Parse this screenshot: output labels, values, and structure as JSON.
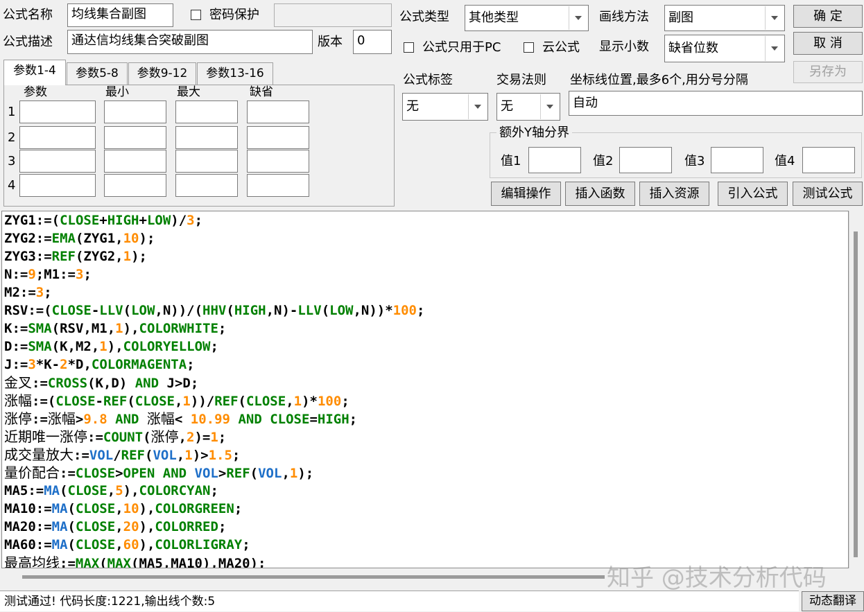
{
  "header": {
    "name_label": "公式名称",
    "name_value": "均线集合副图",
    "password_label": "密码保护",
    "desc_label": "公式描述",
    "desc_value": "通达信均线集合突破副图",
    "version_label": "版本",
    "version_value": "0",
    "type_label": "公式类型",
    "type_value": "其他类型",
    "draw_label": "画线方法",
    "draw_value": "副图",
    "pc_only_label": "公式只用于PC",
    "cloud_label": "云公式",
    "decimals_label": "显示小数",
    "decimals_value": "缺省位数"
  },
  "buttons": {
    "ok": "确  定",
    "cancel": "取  消",
    "save_as": "另存为"
  },
  "tabs": [
    "参数1-4",
    "参数5-8",
    "参数9-12",
    "参数13-16"
  ],
  "params": {
    "headers": [
      "参数",
      "最小",
      "最大",
      "缺省"
    ],
    "rows": [
      "1",
      "2",
      "3",
      "4"
    ]
  },
  "options": {
    "tag_label": "公式标签",
    "tag_value": "无",
    "rule_label": "交易法则",
    "rule_value": "无",
    "coord_label": "坐标线位置,最多6个,用分号分隔",
    "coord_value": "自动",
    "yaxis_group": "额外Y轴分界",
    "y_labels": [
      "值1",
      "值2",
      "值3",
      "值4"
    ]
  },
  "actions": [
    "编辑操作",
    "插入函数",
    "插入资源",
    "引入公式",
    "测试公式"
  ],
  "code_lines": [
    [
      [
        "t",
        "ZYG1:=("
      ],
      [
        "fn",
        "CLOSE"
      ],
      [
        "t",
        "+"
      ],
      [
        "fn",
        "HIGH"
      ],
      [
        "t",
        "+"
      ],
      [
        "fn",
        "LOW"
      ],
      [
        "t",
        ")/"
      ],
      [
        "num",
        "3"
      ],
      [
        "t",
        ";"
      ]
    ],
    [
      [
        "t",
        "ZYG2:="
      ],
      [
        "fn",
        "EMA"
      ],
      [
        "t",
        "(ZYG1,"
      ],
      [
        "num",
        "10"
      ],
      [
        "t",
        ");"
      ]
    ],
    [
      [
        "t",
        "ZYG3:="
      ],
      [
        "fn",
        "REF"
      ],
      [
        "t",
        "(ZYG2,"
      ],
      [
        "num",
        "1"
      ],
      [
        "t",
        ");"
      ]
    ],
    [
      [
        "t",
        "N:="
      ],
      [
        "num",
        "9"
      ],
      [
        "t",
        ";M1:="
      ],
      [
        "num",
        "3"
      ],
      [
        "t",
        ";"
      ]
    ],
    [
      [
        "t",
        "M2:="
      ],
      [
        "num",
        "3"
      ],
      [
        "t",
        ";"
      ]
    ],
    [
      [
        "t",
        "RSV:=("
      ],
      [
        "fn",
        "CLOSE"
      ],
      [
        "t",
        "-"
      ],
      [
        "fn",
        "LLV"
      ],
      [
        "t",
        "("
      ],
      [
        "fn",
        "LOW"
      ],
      [
        "t",
        ",N))/("
      ],
      [
        "fn",
        "HHV"
      ],
      [
        "t",
        "("
      ],
      [
        "fn",
        "HIGH"
      ],
      [
        "t",
        ",N)-"
      ],
      [
        "fn",
        "LLV"
      ],
      [
        "t",
        "("
      ],
      [
        "fn",
        "LOW"
      ],
      [
        "t",
        ",N))*"
      ],
      [
        "num",
        "100"
      ],
      [
        "t",
        ";"
      ]
    ],
    [
      [
        "t",
        "K:="
      ],
      [
        "fn",
        "SMA"
      ],
      [
        "t",
        "(RSV,M1,"
      ],
      [
        "num",
        "1"
      ],
      [
        "t",
        "),"
      ],
      [
        "col",
        "COLORWHITE"
      ],
      [
        "t",
        ";"
      ]
    ],
    [
      [
        "t",
        "D:="
      ],
      [
        "fn",
        "SMA"
      ],
      [
        "t",
        "(K,M2,"
      ],
      [
        "num",
        "1"
      ],
      [
        "t",
        "),"
      ],
      [
        "col",
        "COLORYELLOW"
      ],
      [
        "t",
        ";"
      ]
    ],
    [
      [
        "t",
        "J:="
      ],
      [
        "num",
        "3"
      ],
      [
        "t",
        "*K-"
      ],
      [
        "num",
        "2"
      ],
      [
        "t",
        "*D,"
      ],
      [
        "col",
        "COLORMAGENTA"
      ],
      [
        "t",
        ";"
      ]
    ],
    [
      [
        "cn",
        "金叉"
      ],
      [
        "t",
        ":="
      ],
      [
        "fn",
        "CROSS"
      ],
      [
        "t",
        "(K,D) "
      ],
      [
        "kw",
        "AND"
      ],
      [
        "t",
        " J>D;"
      ]
    ],
    [
      [
        "cn",
        "涨幅"
      ],
      [
        "t",
        ":=("
      ],
      [
        "fn",
        "CLOSE"
      ],
      [
        "t",
        "-"
      ],
      [
        "fn",
        "REF"
      ],
      [
        "t",
        "("
      ],
      [
        "fn",
        "CLOSE"
      ],
      [
        "t",
        ","
      ],
      [
        "num",
        "1"
      ],
      [
        "t",
        "))/"
      ],
      [
        "fn",
        "REF"
      ],
      [
        "t",
        "("
      ],
      [
        "fn",
        "CLOSE"
      ],
      [
        "t",
        ","
      ],
      [
        "num",
        "1"
      ],
      [
        "t",
        ")*"
      ],
      [
        "num",
        "100"
      ],
      [
        "t",
        ";"
      ]
    ],
    [
      [
        "cn",
        "涨停"
      ],
      [
        "t",
        ":="
      ],
      [
        "cn",
        "涨幅"
      ],
      [
        "t",
        ">"
      ],
      [
        "num",
        "9.8"
      ],
      [
        "t",
        " "
      ],
      [
        "kw",
        "AND"
      ],
      [
        "t",
        " "
      ],
      [
        "cn",
        "涨幅"
      ],
      [
        "t",
        "< "
      ],
      [
        "num",
        "10.99"
      ],
      [
        "t",
        " "
      ],
      [
        "kw",
        "AND"
      ],
      [
        "t",
        " "
      ],
      [
        "fn",
        "CLOSE"
      ],
      [
        "t",
        "="
      ],
      [
        "fn",
        "HIGH"
      ],
      [
        "t",
        ";"
      ]
    ],
    [
      [
        "cn",
        "近期唯一涨停"
      ],
      [
        "t",
        ":="
      ],
      [
        "fn",
        "COUNT"
      ],
      [
        "t",
        "("
      ],
      [
        "cn",
        "涨停"
      ],
      [
        "t",
        ","
      ],
      [
        "num",
        "2"
      ],
      [
        "t",
        ")="
      ],
      [
        "num",
        "1"
      ],
      [
        "t",
        ";"
      ]
    ],
    [
      [
        "cn",
        "成交量放大"
      ],
      [
        "t",
        ":="
      ],
      [
        "fb",
        "VOL"
      ],
      [
        "t",
        "/"
      ],
      [
        "fn",
        "REF"
      ],
      [
        "t",
        "("
      ],
      [
        "fb",
        "VOL"
      ],
      [
        "t",
        ","
      ],
      [
        "num",
        "1"
      ],
      [
        "t",
        ")>"
      ],
      [
        "num",
        "1.5"
      ],
      [
        "t",
        ";"
      ]
    ],
    [
      [
        "cn",
        "量价配合"
      ],
      [
        "t",
        ":="
      ],
      [
        "fn",
        "CLOSE"
      ],
      [
        "t",
        ">"
      ],
      [
        "fn",
        "OPEN"
      ],
      [
        "t",
        " "
      ],
      [
        "kw",
        "AND"
      ],
      [
        "t",
        " "
      ],
      [
        "fb",
        "VOL"
      ],
      [
        "t",
        ">"
      ],
      [
        "fn",
        "REF"
      ],
      [
        "t",
        "("
      ],
      [
        "fb",
        "VOL"
      ],
      [
        "t",
        ","
      ],
      [
        "num",
        "1"
      ],
      [
        "t",
        ");"
      ]
    ],
    [
      [
        "t",
        "MA5:="
      ],
      [
        "fb",
        "MA"
      ],
      [
        "t",
        "("
      ],
      [
        "fn",
        "CLOSE"
      ],
      [
        "t",
        ","
      ],
      [
        "num",
        "5"
      ],
      [
        "t",
        "),"
      ],
      [
        "col",
        "COLORCYAN"
      ],
      [
        "t",
        ";"
      ]
    ],
    [
      [
        "t",
        "MA10:="
      ],
      [
        "fb",
        "MA"
      ],
      [
        "t",
        "("
      ],
      [
        "fn",
        "CLOSE"
      ],
      [
        "t",
        ","
      ],
      [
        "num",
        "10"
      ],
      [
        "t",
        "),"
      ],
      [
        "col",
        "COLORGREEN"
      ],
      [
        "t",
        ";"
      ]
    ],
    [
      [
        "t",
        "MA20:="
      ],
      [
        "fb",
        "MA"
      ],
      [
        "t",
        "("
      ],
      [
        "fn",
        "CLOSE"
      ],
      [
        "t",
        ","
      ],
      [
        "num",
        "20"
      ],
      [
        "t",
        "),"
      ],
      [
        "col",
        "COLORRED"
      ],
      [
        "t",
        ";"
      ]
    ],
    [
      [
        "t",
        "MA60:="
      ],
      [
        "fb",
        "MA"
      ],
      [
        "t",
        "("
      ],
      [
        "fn",
        "CLOSE"
      ],
      [
        "t",
        ","
      ],
      [
        "num",
        "60"
      ],
      [
        "t",
        "),"
      ],
      [
        "col",
        "COLORLIGRAY"
      ],
      [
        "t",
        ";"
      ]
    ],
    [
      [
        "cn",
        "最高均线"
      ],
      [
        "t",
        ":="
      ],
      [
        "fn",
        "MAX"
      ],
      [
        "t",
        "("
      ],
      [
        "fn",
        "MAX"
      ],
      [
        "t",
        "(MA5,MA10),MA20);"
      ]
    ]
  ],
  "status": {
    "text": "测试通过! 代码长度:1221,输出线个数:5",
    "translate_button": "动态翻译"
  },
  "watermark": "知乎 @技术分析代码"
}
